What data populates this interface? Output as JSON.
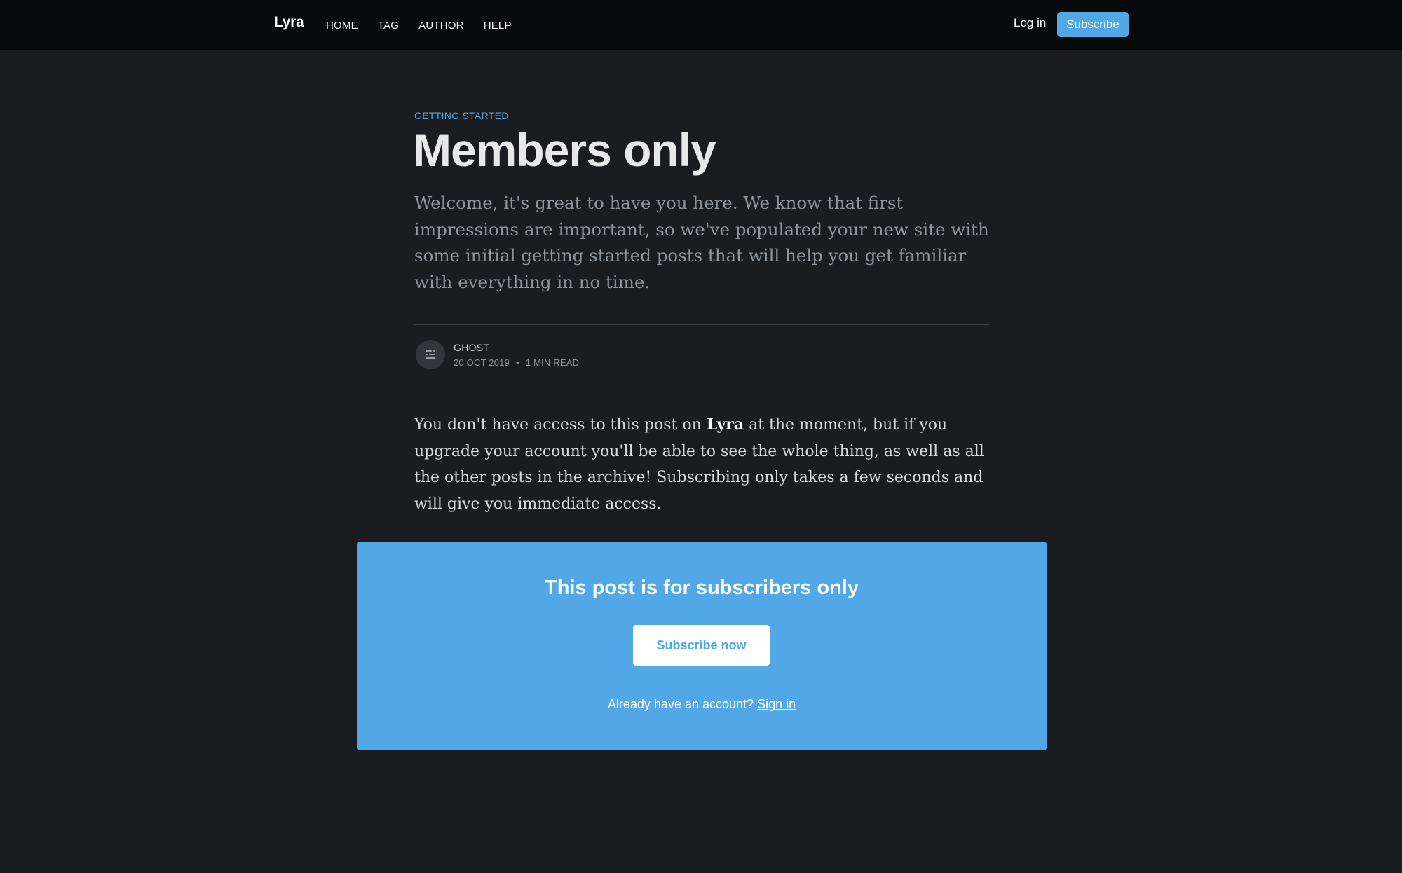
{
  "header": {
    "logo": "Lyra",
    "nav": [
      "HOME",
      "TAG",
      "AUTHOR",
      "HELP"
    ],
    "login_label": "Log in",
    "subscribe_label": "Subscribe"
  },
  "post": {
    "tag": "GETTING STARTED",
    "title": "Members only",
    "excerpt": "Welcome, it's great to have you here. We know that first impressions are important, so we've populated your new site with some initial getting started posts that will help you get familiar with everything in no time.",
    "author": "GHOST",
    "date": "20 OCT 2019",
    "reading_time": "1 MIN READ",
    "body_before": "You don't have access to this post on ",
    "body_site": "Lyra",
    "body_after": " at the moment, but if you upgrade your account you'll be able to see the whole thing, as well as all the other posts in the archive! Subscribing only takes a few seconds and will give you immediate access."
  },
  "cta": {
    "title": "This post is for subscribers only",
    "button_label": "Subscribe now",
    "signin_prompt": "Already have an account?",
    "signin_link": "Sign in"
  },
  "colors": {
    "accent": "#52a7e6",
    "background": "#1b1c20",
    "header_background": "#08090b"
  },
  "icons": {
    "avatar": "ghost-logo-icon"
  }
}
